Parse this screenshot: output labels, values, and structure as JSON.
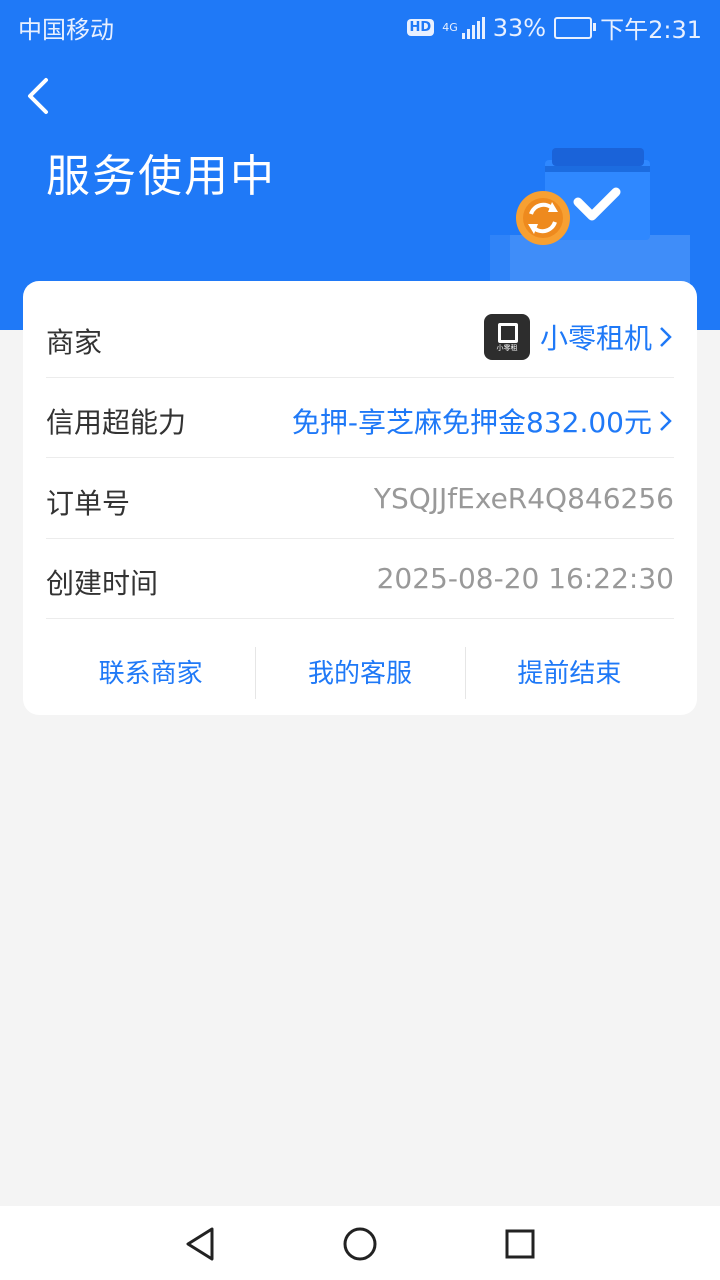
{
  "status_bar": {
    "carrier": "中国移动",
    "hd": "HD",
    "network": "4G",
    "battery": "33%",
    "time": "下午2:31"
  },
  "header": {
    "title": "服务使用中"
  },
  "order": {
    "merchant": {
      "label": "商家",
      "logo_text": "小零租",
      "value": "小零租机"
    },
    "credit": {
      "label": "信用超能力",
      "value": "免押-享芝麻免押金832.00元"
    },
    "order_no": {
      "label": "订单号",
      "value": "YSQJJfExeR4Q846256"
    },
    "created": {
      "label": "创建时间",
      "value": "2025-08-20 16:22:30"
    }
  },
  "actions": {
    "contact": "联系商家",
    "service": "我的客服",
    "end": "提前结束"
  },
  "colors": {
    "brand": "#1f79f7",
    "background": "#f4f4f4"
  },
  "icons": {
    "back": "chevron-left-icon",
    "arrow": "chevron-right-icon",
    "nav_back": "triangle-back-icon",
    "nav_home": "circle-home-icon",
    "nav_recent": "square-recent-icon"
  }
}
